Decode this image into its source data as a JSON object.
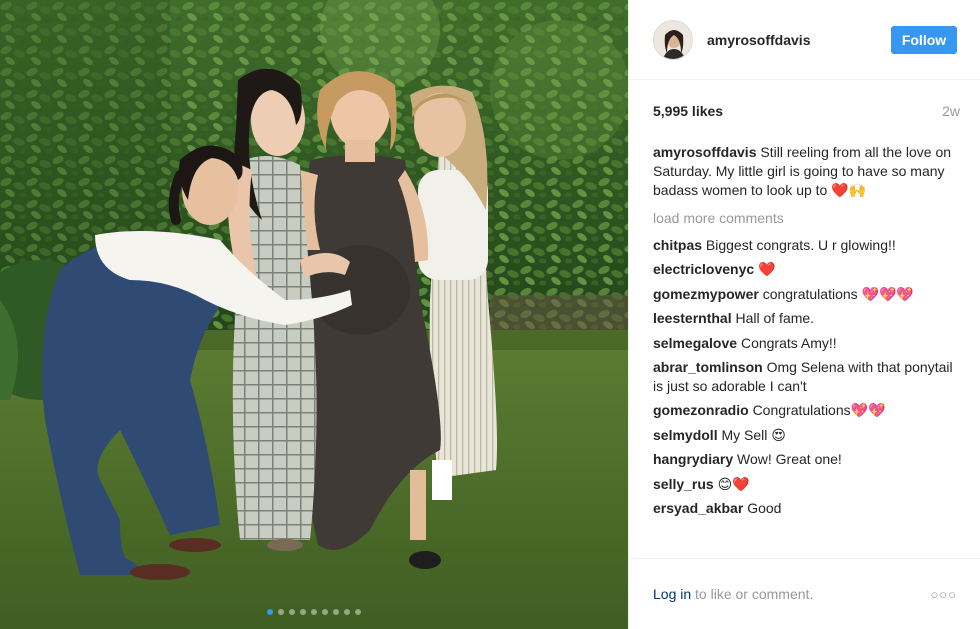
{
  "post": {
    "username": "amyrosoffdavis",
    "follow_label": "Follow",
    "likes": "5,995 likes",
    "time_ago": "2w",
    "caption_user": "amyrosoffdavis",
    "caption_text": "Still reeling from all the love on Saturday. My little girl is going to have so many badass women to look up to",
    "caption_emoji": "❤️🙌"
  },
  "load_more_label": "load more comments",
  "comments": [
    {
      "user": "chitpas",
      "text": "Biggest congrats. U r glowing!!"
    },
    {
      "user": "electriclovenyc",
      "text": "❤️"
    },
    {
      "user": "gomezmypower",
      "text": "congratulations 💖💖💖"
    },
    {
      "user": "leesternthal",
      "text": "Hall of fame."
    },
    {
      "user": "selmegalove",
      "text": "Congrats Amy!!"
    },
    {
      "user": "abrar_tomlinson",
      "text": "Omg Selena with that ponytail is just so adorable I can't"
    },
    {
      "user": "gomezonradio",
      "text": "Congratulations💖💖"
    },
    {
      "user": "selmydoll",
      "text": "My Sell 😍"
    },
    {
      "user": "hangrydiary",
      "text": "Wow! Great one!"
    },
    {
      "user": "selly_rus",
      "text": "😊❤️"
    },
    {
      "user": "ersyad_akbar",
      "text": "Good"
    }
  ],
  "footer": {
    "login_label": "Log in",
    "login_suffix": "to like or comment.",
    "more_icon": "ellipsis-icon"
  },
  "photo": {
    "carousel_count": 9,
    "carousel_active": 1
  },
  "colors": {
    "accent": "#3897f0",
    "text": "#262626",
    "muted": "#999999",
    "link": "#003569"
  }
}
